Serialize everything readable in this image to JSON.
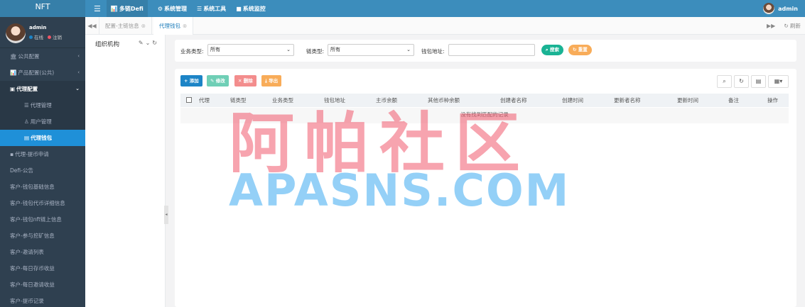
{
  "brand": "NFT",
  "topnav": {
    "items": [
      {
        "icon": "bar-chart-icon",
        "label": "多链Defi",
        "active": true
      },
      {
        "icon": "gear-icon",
        "label": "系统管理"
      },
      {
        "icon": "list-icon",
        "label": "系统工具"
      },
      {
        "icon": "video-icon",
        "label": "系统监控"
      }
    ],
    "user": "admin"
  },
  "sidebar": {
    "user": {
      "name": "admin",
      "online": "在线",
      "logout": "注销"
    },
    "items": [
      {
        "label": "公共配置",
        "icon": "bank-icon",
        "chevron": "‹"
      },
      {
        "label": "产品配置(公共)",
        "icon": "bar-chart-icon",
        "chevron": "‹"
      },
      {
        "label": "代理配置",
        "icon": "image-icon",
        "chevron": "⌄",
        "open": true
      },
      {
        "label": "代理管理",
        "icon": "list-icon",
        "sub": true
      },
      {
        "label": "用户管理",
        "icon": "user-icon",
        "sub": true
      },
      {
        "label": "代理钱包",
        "icon": "book-icon",
        "sub": true,
        "active": true
      },
      {
        "label": "代理-提币申请",
        "icon": "briefcase-icon"
      },
      {
        "label": "Defi-公告"
      },
      {
        "label": "客户-钱包基础信息"
      },
      {
        "label": "客户-钱包代币详细信息"
      },
      {
        "label": "客户-钱包nft链上信息"
      },
      {
        "label": "客户-参与挖矿信息"
      },
      {
        "label": "客户-邀请列表"
      },
      {
        "label": "客户-每日存币收益"
      },
      {
        "label": "客户-每日邀请收益"
      },
      {
        "label": "客户-提币记录"
      }
    ]
  },
  "tabs": {
    "items": [
      {
        "label": "配置-主链信息",
        "active": false
      },
      {
        "label": "代理钱包",
        "active": true
      }
    ],
    "refresh": "刷新"
  },
  "org": {
    "title": "组织机构"
  },
  "search": {
    "business_type_label": "业务类型:",
    "business_type_value": "所有",
    "chain_type_label": "链类型:",
    "chain_type_value": "所有",
    "wallet_label": "钱包地址:",
    "wallet_value": "",
    "search_button": "搜索",
    "reset_button": "重置"
  },
  "toolbar": {
    "add": "添加",
    "edit": "修改",
    "delete": "删除",
    "export": "导出"
  },
  "table": {
    "columns": [
      "代理",
      "链类型",
      "业务类型",
      "钱包地址",
      "主币余额",
      "其他币种余额",
      "创建者名称",
      "创建时间",
      "更新者名称",
      "更新时间",
      "备注",
      "操作"
    ],
    "empty_text": "没有找到匹配的记录"
  },
  "watermark": {
    "cn": "阿帕社区",
    "en": "APASNS.COM"
  },
  "colors": {
    "topbar": "#3c8dbc",
    "sidebar": "#2f4050",
    "active": "#1f90d8",
    "search": "#1ab394",
    "reset": "#f8ac59",
    "add": "#1c84c6",
    "edit": "#6fcfb6",
    "delete": "#f38d8d",
    "export": "#f8ac59"
  }
}
